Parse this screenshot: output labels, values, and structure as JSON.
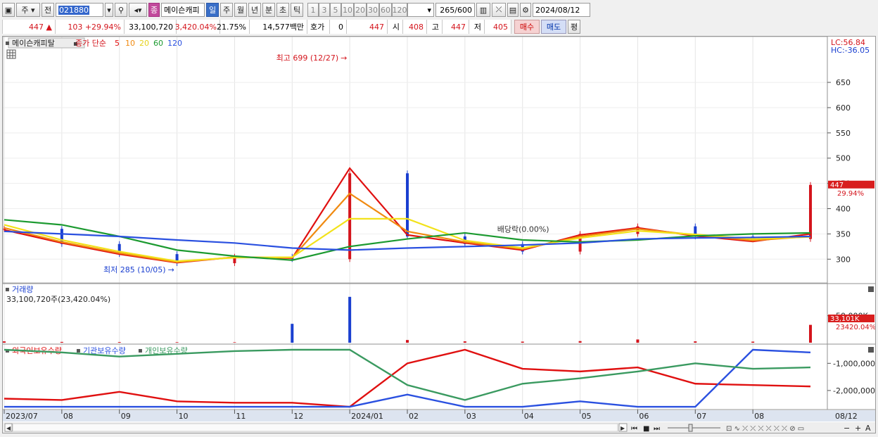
{
  "toolbar": {
    "type_label": "주",
    "prev_label": "전",
    "stock_code": "021880",
    "chart_label": "종",
    "stock_name": "메이슨캐피",
    "periods": [
      "일",
      "주",
      "월",
      "년",
      "분",
      "초",
      "틱"
    ],
    "active_period": "일",
    "intervals": [
      "1",
      "3",
      "5",
      "10",
      "20",
      "30",
      "60",
      "120"
    ],
    "count_value": "265",
    "count_max": "/600",
    "date": "2024/08/12"
  },
  "quote": {
    "price": "447",
    "change": "103",
    "change_pct": "+29.94%",
    "volume": "33,100,720",
    "volume_pct": "3,420.04%",
    "turnover": "21.75%",
    "amount": "14,577백만",
    "hoga_label": "호가",
    "hoga_value": "0",
    "hoga_price": "447",
    "open_label": "시",
    "open_value": "408",
    "high_label": "고",
    "high_value": "447",
    "low_label": "저",
    "low_value": "405",
    "buy_label": "매수",
    "sell_label": "매도",
    "eval_label": "평"
  },
  "price_panel": {
    "name": "메이슨캐피탈",
    "ma_label": "종가 단순",
    "ma_periods": [
      "5",
      "10",
      "20",
      "60",
      "120"
    ],
    "lc": "LC:56.84",
    "hc": "HC:-36.05",
    "high_note": "최고 699 (12/27)",
    "low_note": "최저 285 (10/05)",
    "dividend_note": "배당락(0.00%)",
    "last_price": "447",
    "last_pct": "29.94%"
  },
  "volume_panel": {
    "title": "거래량",
    "summary": "33,100,720주(23,420.04%)",
    "tick": "50,000K",
    "last_value": "33,101K",
    "last_pct": "23420.04%"
  },
  "holding_panel": {
    "legend": [
      "외국인보유수량",
      "기관보유수량",
      "개인보유수량"
    ],
    "ticks": [
      "-1,000,000",
      "-2,000,000"
    ]
  },
  "x_axis": {
    "labels": [
      "2023/07",
      "08",
      "09",
      "10",
      "11",
      "12",
      "2024/01",
      "02",
      "03",
      "04",
      "05",
      "06",
      "07",
      "08"
    ],
    "end_label": "08/12"
  },
  "colors": {
    "up": "#d4141c",
    "down": "#1a3fd0",
    "ma5": "#e01010",
    "ma10": "#f08a10",
    "ma20": "#f2e21a",
    "ma60": "#1c9a30",
    "ma120": "#2a50e0",
    "foreign": "#e01010",
    "institution": "#2a50e0",
    "individual": "#3a9a60"
  },
  "chart_data": [
    {
      "type": "line",
      "title": "",
      "x": [
        "2023/07",
        "08",
        "09",
        "10",
        "11",
        "12",
        "2024/01",
        "02",
        "03",
        "04",
        "05",
        "06",
        "07",
        "08",
        "08/12"
      ],
      "ylim": [
        260,
        710
      ],
      "yticks": [
        300,
        350,
        400,
        450,
        500,
        550,
        600,
        650
      ],
      "series": [
        {
          "name": "종가",
          "values": [
            360,
            330,
            310,
            292,
            305,
            300,
            470,
            345,
            330,
            315,
            350,
            365,
            345,
            340,
            447
          ]
        },
        {
          "name": "5",
          "values": [
            358,
            332,
            310,
            293,
            304,
            302,
            480,
            348,
            332,
            318,
            348,
            362,
            346,
            335,
            350
          ]
        },
        {
          "name": "10",
          "values": [
            362,
            334,
            312,
            294,
            304,
            303,
            430,
            355,
            334,
            320,
            345,
            360,
            348,
            337,
            345
          ]
        },
        {
          "name": "20",
          "values": [
            368,
            338,
            315,
            296,
            303,
            304,
            380,
            380,
            337,
            322,
            342,
            356,
            349,
            340,
            344
          ]
        },
        {
          "name": "60",
          "values": [
            378,
            368,
            345,
            318,
            306,
            298,
            325,
            340,
            352,
            338,
            334,
            338,
            346,
            350,
            352
          ]
        },
        {
          "name": "120",
          "values": [
            355,
            350,
            345,
            338,
            332,
            322,
            318,
            322,
            325,
            328,
            332,
            340,
            342,
            343,
            345
          ]
        }
      ],
      "annotations": [
        {
          "text": "최고 699 (12/27)",
          "x": "12/27",
          "y": 699
        },
        {
          "text": "최저 285 (10/05)",
          "x": "10/05",
          "y": 285
        }
      ]
    },
    {
      "type": "bar",
      "title": "거래량",
      "x": [
        "2023/07",
        "08",
        "09",
        "10",
        "11",
        "12",
        "2024/01",
        "02",
        "03",
        "04",
        "05",
        "06",
        "07",
        "08",
        "08/12"
      ],
      "ylim": [
        0,
        90000
      ],
      "yticks": [
        50000
      ],
      "series": [
        {
          "name": "거래량",
          "values": [
            2500,
            1500,
            1200,
            1000,
            900,
            35000,
            85000,
            5000,
            2500,
            2000,
            3000,
            6000,
            2500,
            2000,
            33101
          ]
        }
      ]
    },
    {
      "type": "line",
      "title": "",
      "x": [
        "2023/07",
        "08",
        "09",
        "10",
        "11",
        "12",
        "2024/01",
        "02",
        "03",
        "04",
        "05",
        "06",
        "07",
        "08",
        "08/12"
      ],
      "ylim": [
        -2650000,
        -500000
      ],
      "yticks": [
        -1000000,
        -2000000
      ],
      "series": [
        {
          "name": "외국인보유수량",
          "values": [
            -2300000,
            -2350000,
            -2050000,
            -2400000,
            -2450000,
            -2450000,
            -2600000,
            -1000000,
            -500000,
            -1200000,
            -1300000,
            -1150000,
            -1750000,
            -1800000,
            -1850000
          ]
        },
        {
          "name": "기관보유수량",
          "values": [
            -2600000,
            -2600000,
            -2600000,
            -2600000,
            -2600000,
            -2600000,
            -2600000,
            -2150000,
            -2600000,
            -2600000,
            -2400000,
            -2600000,
            -2600000,
            -500000,
            -600000
          ]
        },
        {
          "name": "개인보유수량",
          "values": [
            -500000,
            -600000,
            -750000,
            -650000,
            -550000,
            -500000,
            -500000,
            -1800000,
            -2350000,
            -1750000,
            -1550000,
            -1300000,
            -1000000,
            -1200000,
            -1150000
          ]
        }
      ]
    }
  ]
}
